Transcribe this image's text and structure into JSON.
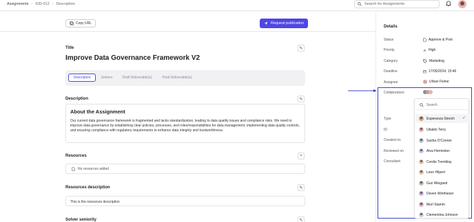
{
  "breadcrumbs": [
    "Assignments",
    "IDD-012",
    "Description"
  ],
  "search": {
    "placeholder": "Search for Assignments"
  },
  "actions": {
    "copy_url": "Copy URL",
    "request_publication": "Request publication"
  },
  "main": {
    "title_label": "Title",
    "title": "Improve Data Governance Framework V2",
    "tabs": [
      {
        "label": "Description",
        "active": true
      },
      {
        "label": "Solvers",
        "active": false
      },
      {
        "label": "Draft Deliverable(s)",
        "active": false
      },
      {
        "label": "Final Deliverable(s)",
        "active": false
      }
    ],
    "description_label": "Description",
    "about_title": "About the Assignment",
    "about_text": "Our current data governance framework is fragmented and lacks standardization, leading to data quality issues and compliance risks. We need to improve data governance by establishing clear policies, processes, and roles/responsibilities for data management, implementing data quality controls, and ensuring compliance with regulatory requirements to enhance data integrity and trustworthiness.",
    "resources_label": "Resources",
    "no_resources": "No resources added",
    "resources_description_label": "Resources description",
    "resources_description_text": "This is the resources description",
    "solver_seniority_label": "Solver seniority"
  },
  "details": {
    "title": "Details",
    "rows": [
      {
        "label": "Status",
        "value": "Approve & Post",
        "icon": "document-icon"
      },
      {
        "label": "Priority",
        "value": "High",
        "icon": "chevron-up-icon"
      },
      {
        "label": "Category",
        "value": "Marketing",
        "icon": "tag-icon"
      },
      {
        "label": "Deadline",
        "value": "17/05/2024, 15:46",
        "icon": "calendar-icon"
      },
      {
        "label": "Assignee",
        "value": "Urban Fisher",
        "icon": "avatar"
      },
      {
        "label": "Collaborators",
        "value": "",
        "icon": "avatars"
      },
      {
        "label": "Type",
        "value": ""
      },
      {
        "label": "ID",
        "value": ""
      },
      {
        "label": "Created on",
        "value": ""
      },
      {
        "label": "Reviewed on",
        "value": ""
      },
      {
        "label": "Consultant",
        "value": ""
      }
    ]
  },
  "dropdown": {
    "search_placeholder": "Search",
    "items": [
      {
        "name": "Esperanza Streich",
        "selected": true,
        "color": "#c9a27e"
      },
      {
        "name": "Ubaldo Terry",
        "selected": false,
        "color": "#e8b1b8"
      },
      {
        "name": "Sasha O'Conner",
        "selected": false,
        "color": "#b9c4d6"
      },
      {
        "name": "Alva Hermiston",
        "selected": false,
        "color": "#c7c3e8"
      },
      {
        "name": "Cordie Tremblay",
        "selected": false,
        "color": "#d9c7b5"
      },
      {
        "name": "Leon Hilpert",
        "selected": false,
        "color": "#e0bfa9"
      },
      {
        "name": "Gus Wiegand",
        "selected": false,
        "color": "#b5c6b0"
      },
      {
        "name": "Deven Wintheiser",
        "selected": false,
        "color": "#c9b7e4"
      },
      {
        "name": "Murl Stamm",
        "selected": false,
        "color": "#d6b3c3"
      },
      {
        "name": "Clementina Johnson",
        "selected": false,
        "color": "#c2cfe0"
      }
    ]
  },
  "colors": {
    "accent": "#4f46e5",
    "highlight": "#3944bc"
  }
}
